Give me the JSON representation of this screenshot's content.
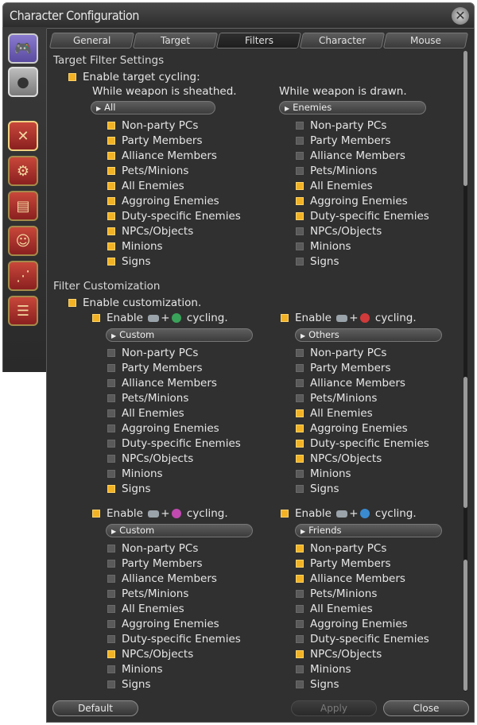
{
  "window": {
    "title": "Character Configuration"
  },
  "tabs": [
    "General",
    "Target",
    "Filters",
    "Character",
    "Mouse"
  ],
  "active_tab": "Filters",
  "target_filter": {
    "heading": "Target Filter Settings",
    "enable_label": "Enable target cycling:",
    "sheathed": {
      "label": "While weapon is sheathed.",
      "dropdown": "All",
      "items": [
        {
          "label": "Non-party PCs",
          "on": true
        },
        {
          "label": "Party Members",
          "on": true
        },
        {
          "label": "Alliance Members",
          "on": true
        },
        {
          "label": "Pets/Minions",
          "on": true
        },
        {
          "label": "All Enemies",
          "on": true
        },
        {
          "label": "Aggroing Enemies",
          "on": true
        },
        {
          "label": "Duty-specific Enemies",
          "on": true
        },
        {
          "label": "NPCs/Objects",
          "on": true
        },
        {
          "label": "Minions",
          "on": true
        },
        {
          "label": "Signs",
          "on": true
        }
      ]
    },
    "drawn": {
      "label": "While weapon is drawn.",
      "dropdown": "Enemies",
      "items": [
        {
          "label": "Non-party PCs",
          "on": false
        },
        {
          "label": "Party Members",
          "on": false
        },
        {
          "label": "Alliance Members",
          "on": false
        },
        {
          "label": "Pets/Minions",
          "on": false
        },
        {
          "label": "All Enemies",
          "on": true
        },
        {
          "label": "Aggroing Enemies",
          "on": true
        },
        {
          "label": "Duty-specific Enemies",
          "on": true
        },
        {
          "label": "NPCs/Objects",
          "on": false
        },
        {
          "label": "Minions",
          "on": false
        },
        {
          "label": "Signs",
          "on": false
        }
      ]
    }
  },
  "filter_custom": {
    "heading": "Filter Customization",
    "enable_label": "Enable customization.",
    "enable_word": "Enable",
    "cycling_word": "cycling.",
    "plus": "+",
    "groups": [
      {
        "button_color": "#3aa35a",
        "dropdown": "Custom",
        "items": [
          {
            "label": "Non-party PCs",
            "on": false
          },
          {
            "label": "Party Members",
            "on": false
          },
          {
            "label": "Alliance Members",
            "on": false
          },
          {
            "label": "Pets/Minions",
            "on": false
          },
          {
            "label": "All Enemies",
            "on": false
          },
          {
            "label": "Aggroing Enemies",
            "on": false
          },
          {
            "label": "Duty-specific Enemies",
            "on": false
          },
          {
            "label": "NPCs/Objects",
            "on": false
          },
          {
            "label": "Minions",
            "on": false
          },
          {
            "label": "Signs",
            "on": true
          }
        ]
      },
      {
        "button_color": "#d03a3a",
        "dropdown": "Others",
        "items": [
          {
            "label": "Non-party PCs",
            "on": false
          },
          {
            "label": "Party Members",
            "on": false
          },
          {
            "label": "Alliance Members",
            "on": false
          },
          {
            "label": "Pets/Minions",
            "on": false
          },
          {
            "label": "All Enemies",
            "on": true
          },
          {
            "label": "Aggroing Enemies",
            "on": true
          },
          {
            "label": "Duty-specific Enemies",
            "on": true
          },
          {
            "label": "NPCs/Objects",
            "on": true
          },
          {
            "label": "Minions",
            "on": false
          },
          {
            "label": "Signs",
            "on": false
          }
        ]
      },
      {
        "button_color": "#c04ab0",
        "dropdown": "Custom",
        "items": [
          {
            "label": "Non-party PCs",
            "on": false
          },
          {
            "label": "Party Members",
            "on": false
          },
          {
            "label": "Alliance Members",
            "on": false
          },
          {
            "label": "Pets/Minions",
            "on": false
          },
          {
            "label": "All Enemies",
            "on": false
          },
          {
            "label": "Aggroing Enemies",
            "on": false
          },
          {
            "label": "Duty-specific Enemies",
            "on": false
          },
          {
            "label": "NPCs/Objects",
            "on": true
          },
          {
            "label": "Minions",
            "on": false
          },
          {
            "label": "Signs",
            "on": false
          }
        ]
      },
      {
        "button_color": "#3a8ad0",
        "dropdown": "Friends",
        "items": [
          {
            "label": "Non-party PCs",
            "on": true
          },
          {
            "label": "Party Members",
            "on": true
          },
          {
            "label": "Alliance Members",
            "on": true
          },
          {
            "label": "Pets/Minions",
            "on": false
          },
          {
            "label": "All Enemies",
            "on": false
          },
          {
            "label": "Aggroing Enemies",
            "on": false
          },
          {
            "label": "Duty-specific Enemies",
            "on": false
          },
          {
            "label": "NPCs/Objects",
            "on": true
          },
          {
            "label": "Minions",
            "on": false
          },
          {
            "label": "Signs",
            "on": false
          }
        ]
      }
    ]
  },
  "footer": {
    "default": "Default",
    "apply": "Apply",
    "close": "Close"
  },
  "icons": [
    "gamepad-icon",
    "mouse-icon",
    "target-icon",
    "gear-icon",
    "card-icon",
    "character-icon",
    "chain-icon",
    "chat-icon",
    "close-icon"
  ]
}
